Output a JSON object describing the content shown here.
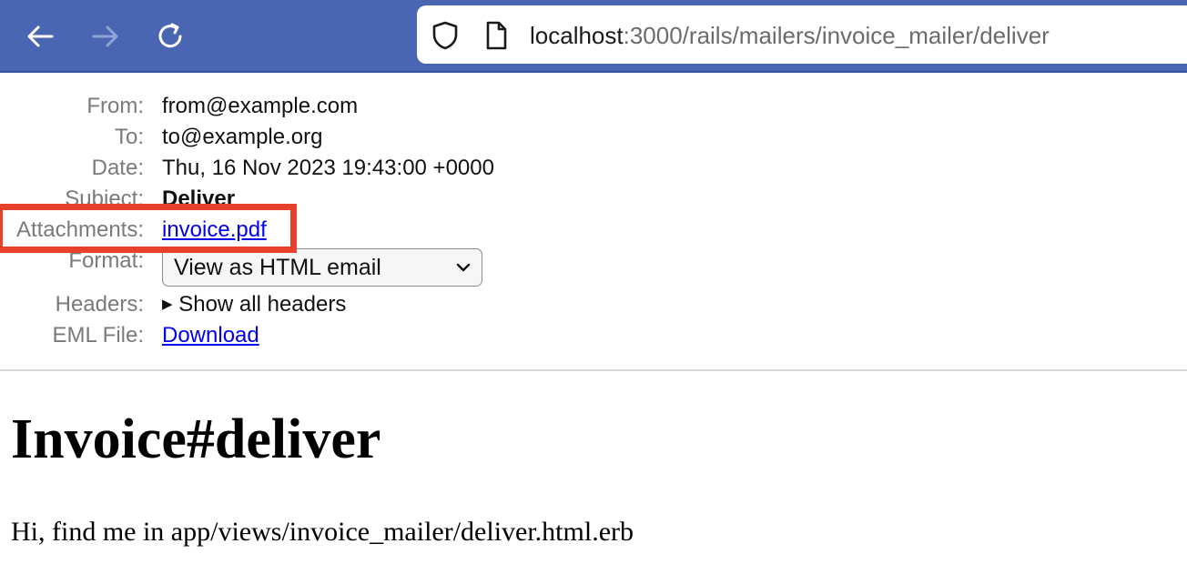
{
  "browser": {
    "url_host": "localhost",
    "url_rest": ":3000/rails/mailers/invoice_mailer/deliver",
    "icons": [
      "back-arrow-icon",
      "forward-arrow-icon",
      "reload-icon",
      "shield-icon",
      "page-icon"
    ]
  },
  "headers": {
    "from_label": "From:",
    "from_value": "from@example.com",
    "to_label": "To:",
    "to_value": "to@example.org",
    "date_label": "Date:",
    "date_value": "Thu, 16 Nov 2023 19:43:00 +0000",
    "subject_label": "Subject:",
    "subject_value": "Deliver",
    "attachments_label": "Attachments:",
    "attachment_name": "invoice.pdf",
    "format_label": "Format:",
    "format_selected": "View as HTML email",
    "headers_label": "Headers:",
    "headers_toggle": "Show all headers",
    "eml_label": "EML File:",
    "eml_link": "Download"
  },
  "mail": {
    "title": "Invoice#deliver",
    "body_text": "Hi, find me in app/views/invoice_mailer/deliver.html.erb"
  },
  "colors": {
    "toolbar": "#4a66b3",
    "highlight": "#e8402a",
    "link": "#0000ee"
  }
}
